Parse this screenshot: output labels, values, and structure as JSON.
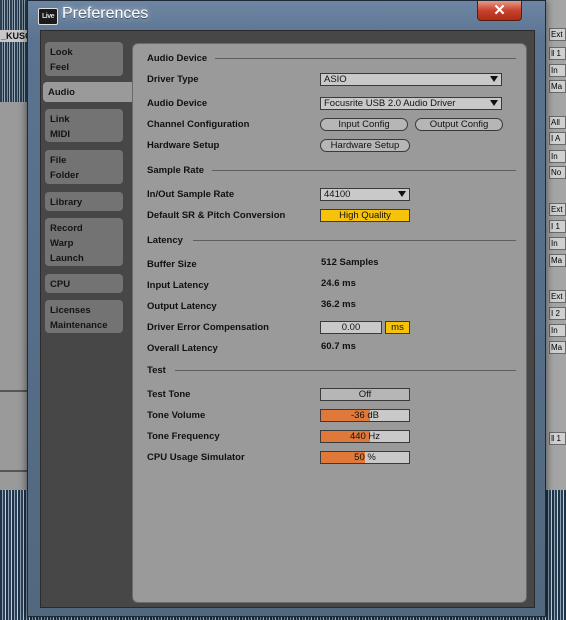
{
  "window": {
    "title": "Preferences",
    "icon_text": "Live",
    "close_glyph": "✕"
  },
  "background": {
    "clip_name": "_KUSC",
    "right_cells": [
      "Ext",
      "‖ 1",
      "In",
      "Ma",
      "All",
      "I A",
      "In",
      "No",
      "Ext",
      "I 1",
      "In",
      "Ma",
      "Ext",
      "I 2",
      "In",
      "Ma",
      "‖ 1"
    ]
  },
  "sidebar": {
    "tabs": [
      {
        "lines": [
          "Look",
          "Feel"
        ]
      },
      {
        "lines": [
          "Audio"
        ]
      },
      {
        "lines": [
          "Link",
          "MIDI"
        ]
      },
      {
        "lines": [
          "File",
          "Folder"
        ]
      },
      {
        "lines": [
          "Library"
        ]
      },
      {
        "lines": [
          "Record",
          "Warp",
          "Launch"
        ]
      },
      {
        "lines": [
          "CPU"
        ]
      },
      {
        "lines": [
          "Licenses",
          "Maintenance"
        ]
      }
    ]
  },
  "audio_device": {
    "section": "Audio Device",
    "driver_type_label": "Driver Type",
    "driver_type_value": "ASIO",
    "audio_device_label": "Audio Device",
    "audio_device_value": "Focusrite USB 2.0 Audio Driver",
    "channel_config_label": "Channel Configuration",
    "input_config": "Input Config",
    "output_config": "Output Config",
    "hardware_setup_label": "Hardware Setup",
    "hardware_setup_button": "Hardware Setup"
  },
  "sample_rate": {
    "section": "Sample Rate",
    "inout_label": "In/Out Sample Rate",
    "inout_value": "44100",
    "default_sr_label": "Default SR & Pitch Conversion",
    "default_sr_value": "High Quality"
  },
  "latency": {
    "section": "Latency",
    "buffer_label": "Buffer Size",
    "buffer_value": "512 Samples",
    "input_label": "Input Latency",
    "input_value": "24.6 ms",
    "output_label": "Output Latency",
    "output_value": "36.2 ms",
    "error_comp_label": "Driver Error Compensation",
    "error_comp_value": "0.00",
    "error_comp_unit": "ms",
    "overall_label": "Overall Latency",
    "overall_value": "60.7 ms"
  },
  "test": {
    "section": "Test",
    "tone_label": "Test Tone",
    "tone_value": "Off",
    "volume_label": "Tone Volume",
    "volume_value": "-36 dB",
    "volume_fill": 0.56,
    "freq_label": "Tone Frequency",
    "freq_value": "440 Hz",
    "freq_fill": 0.56,
    "cpu_label": "CPU Usage Simulator",
    "cpu_value": "50 %",
    "cpu_fill": 0.5
  },
  "colors": {
    "accent_yellow": "#f6c20a",
    "slider_orange": "#e0783a",
    "panel_gray": "#9a9a9a"
  }
}
